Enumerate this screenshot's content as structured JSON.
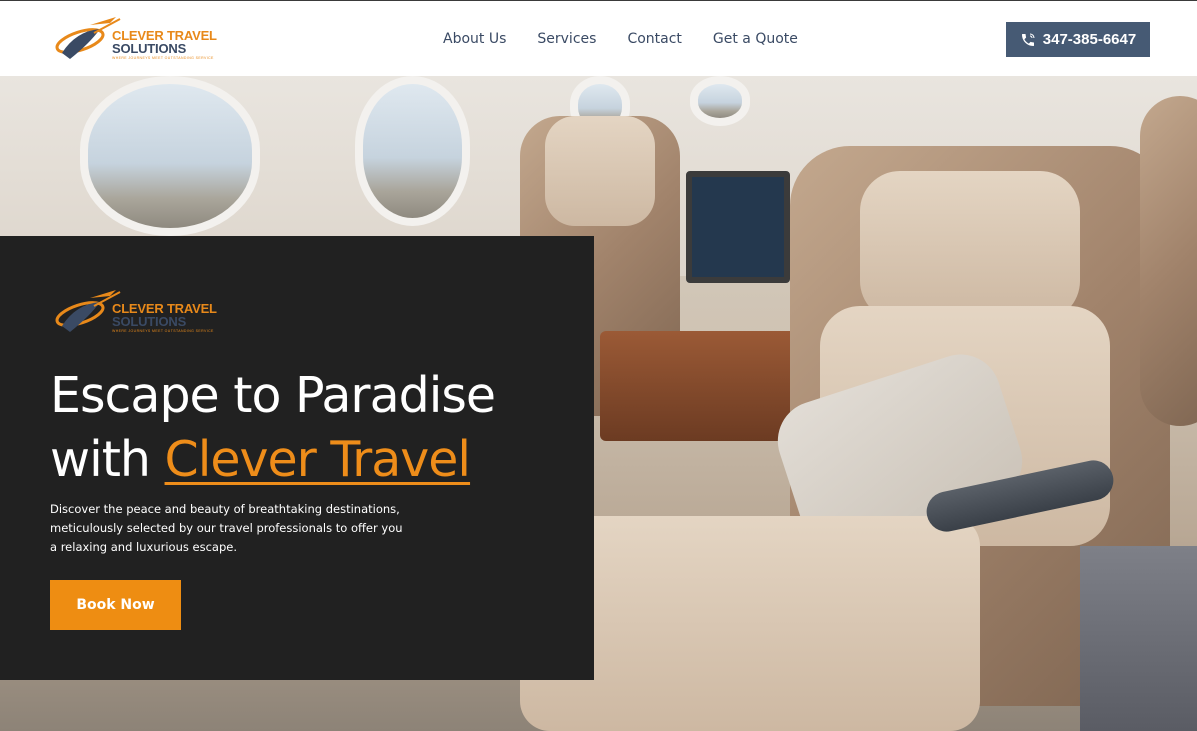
{
  "brand": {
    "name_line1": "CLEVER TRAVEL",
    "name_line2": "SOLUTIONS",
    "tagline": "WHERE JOURNEYS MEET OUTSTANDING SERVICE",
    "orange": "#ee8d12",
    "navy": "#3a4a64"
  },
  "nav": {
    "items": [
      {
        "label": "About Us"
      },
      {
        "label": "Services"
      },
      {
        "label": "Contact"
      },
      {
        "label": "Get a Quote"
      }
    ],
    "phone": "347-385-6647",
    "phone_icon": "phone-icon"
  },
  "hero": {
    "headline_part1": "Escape to Paradise",
    "headline_part2": "with ",
    "headline_accent": "Clever Travel",
    "description": "Discover the peace and beauty of breathtaking destinations, meticulously selected by our travel professionals to offer you a relaxing and luxurious escape.",
    "cta_label": "Book Now"
  }
}
